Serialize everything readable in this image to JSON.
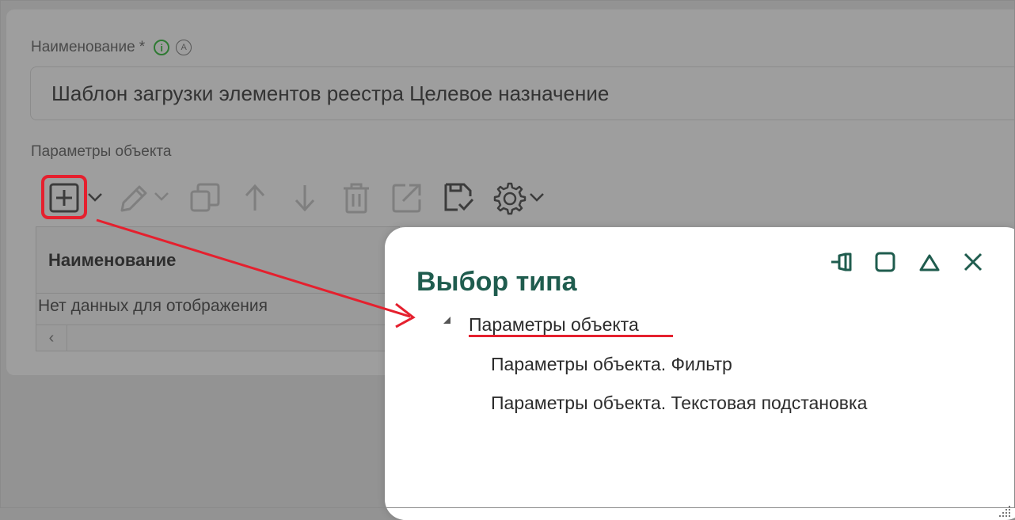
{
  "form": {
    "name_label": "Наименование",
    "required_mark": "*",
    "info_badge": "i",
    "auto_badge": "A",
    "name_value": "Шаблон загрузки элементов реестра Целевое назначение",
    "params_label": "Параметры объекта"
  },
  "toolbar": {
    "icons": [
      "add-icon",
      "edit-icon",
      "copy-icon",
      "move-up-icon",
      "move-down-icon",
      "delete-icon",
      "open-external-icon",
      "save-icon",
      "settings-icon"
    ]
  },
  "grid": {
    "column_header": "Наименование",
    "empty_text": "Нет данных для отображения",
    "scroll_left": "‹"
  },
  "dialog": {
    "title": "Выбор типа",
    "tree": {
      "root": "Параметры объекта",
      "children": [
        "Параметры объекта. Фильтр",
        "Параметры объекта. Текстовая подстановка"
      ]
    }
  },
  "colors": {
    "accent_green": "#1f5c4e",
    "highlight_red": "#e5202e",
    "info_green": "#2f7a33"
  }
}
